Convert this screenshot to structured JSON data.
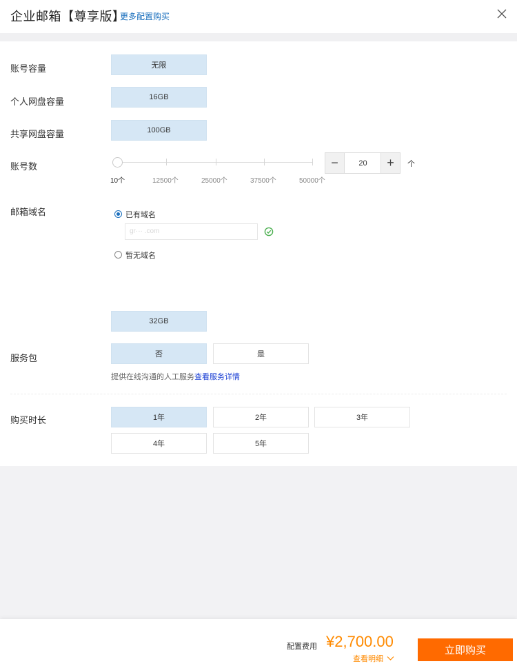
{
  "header": {
    "title": "企业邮箱【尊享版】",
    "more_link": "更多配置购买"
  },
  "fields": {
    "account_capacity": {
      "label": "账号容量",
      "options": [
        "无限"
      ],
      "selected": "无限"
    },
    "personal_disk": {
      "label": "个人网盘容量",
      "options": [
        "16GB"
      ],
      "selected": "16GB"
    },
    "shared_disk": {
      "label": "共享网盘容量",
      "options": [
        "100GB"
      ],
      "selected": "100GB"
    },
    "account_count": {
      "label": "账号数",
      "ticks": [
        "10个",
        "12500个",
        "25000个",
        "37500个",
        "50000个"
      ],
      "slider_min": 10,
      "slider_max": 50000,
      "value": "20",
      "unit": "个",
      "minus": "−",
      "plus": "+"
    },
    "domain": {
      "label": "邮箱域名",
      "have_domain": "已有域名",
      "input_value": "gr··· .com",
      "no_domain": "暂无域名"
    },
    "extra_capacity": {
      "options": [
        "32GB"
      ],
      "selected": "32GB"
    },
    "service": {
      "label": "服务包",
      "options": [
        "否",
        "是"
      ],
      "selected": "否",
      "note": "提供在线沟通的人工服务",
      "note_link": "查看服务详情"
    },
    "duration": {
      "label": "购买时长",
      "options": [
        "1年",
        "2年",
        "3年",
        "4年",
        "5年"
      ],
      "selected": "1年"
    }
  },
  "footer": {
    "fee_label": "配置费用",
    "fee_value": "¥2,700.00",
    "detail_link": "查看明细",
    "buy_label": "立即购买"
  },
  "colors": {
    "accent_blue": "#1a6fbd",
    "selected_bg": "#d6e7f5",
    "price_orange": "#ff8a00",
    "buy_orange": "#ff6a00",
    "check_green": "#4caf50"
  },
  "icons": {
    "close": "close-icon",
    "valid": "check-circle-icon",
    "detail": "chevron-down-icon"
  }
}
